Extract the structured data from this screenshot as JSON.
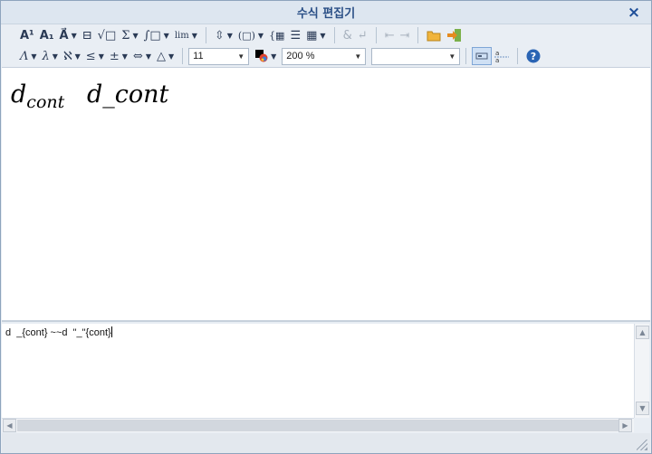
{
  "window": {
    "title": "수식 편집기",
    "close_icon": "×"
  },
  "toolbar1": [
    {
      "name": "superscript-button",
      "label": "A¹"
    },
    {
      "name": "subscript-button",
      "label": "A₁"
    },
    {
      "name": "overline-button",
      "label": "A⃗",
      "dropdown": true
    },
    {
      "name": "fraction-button",
      "label": "⊟"
    },
    {
      "name": "root-button",
      "label": "√□"
    },
    {
      "name": "sum-button",
      "label": "Σ",
      "dropdown": true
    },
    {
      "name": "integral-button",
      "label": "∫□",
      "dropdown": true
    },
    {
      "name": "limit-button",
      "label": "lim",
      "dropdown": true
    },
    {
      "name": "arrow-decoration-button",
      "label": "⇳",
      "dropdown": true
    },
    {
      "name": "bracket-button",
      "label": "(□)",
      "dropdown": true
    },
    {
      "name": "cases-button",
      "label": "{▦"
    },
    {
      "name": "pile-button",
      "label": "☰"
    },
    {
      "name": "matrix-button",
      "label": "▦",
      "dropdown": true
    },
    {
      "name": "align-button",
      "label": "&",
      "disabled": true
    },
    {
      "name": "newline-button",
      "label": "↵",
      "disabled": true
    },
    {
      "name": "prev-button",
      "label": "⇤",
      "disabled": true
    },
    {
      "name": "next-button",
      "label": "⇥",
      "disabled": true
    },
    {
      "name": "open-file-button",
      "label": "📂"
    },
    {
      "name": "insert-button",
      "label": "➔"
    }
  ],
  "toolbar2": {
    "symbols": [
      {
        "name": "greek-capital-button",
        "label": "Λ"
      },
      {
        "name": "greek-lower-button",
        "label": "λ"
      },
      {
        "name": "hebrew-button",
        "label": "ℵ"
      },
      {
        "name": "relation-button",
        "label": "≤"
      },
      {
        "name": "operator-button",
        "label": "±"
      },
      {
        "name": "arrow-button",
        "label": "⇔"
      },
      {
        "name": "misc-symbol-button",
        "label": "△"
      }
    ],
    "font_size": "11",
    "zoom": "200 %",
    "font_name": ""
  },
  "preview": {
    "base1": "d",
    "sub1": "cont",
    "expr2": "d_cont"
  },
  "editor": {
    "script": "d  _{cont} ~~d  \"_\"{cont}"
  }
}
